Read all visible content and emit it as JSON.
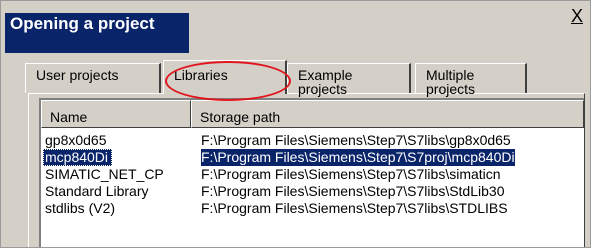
{
  "window": {
    "title": "Opening a project",
    "close_label": "X"
  },
  "tabs": [
    {
      "label": "User projects",
      "selected": false
    },
    {
      "label": "Libraries",
      "selected": true
    },
    {
      "label": "Example projects",
      "selected": false
    },
    {
      "label": "Multiple projects",
      "selected": false
    }
  ],
  "list": {
    "columns": [
      "Name",
      "Storage path"
    ],
    "rows": [
      {
        "name": "gp8x0d65",
        "path": "F:\\Program Files\\Siemens\\Step7\\S7libs\\gp8x0d65",
        "selected": false
      },
      {
        "name": "mcp840Di",
        "path": "F:\\Program Files\\Siemens\\Step7\\S7proj\\mcp840Di",
        "selected": true
      },
      {
        "name": "SIMATIC_NET_CP",
        "path": "F:\\Program Files\\Siemens\\Step7\\S7libs\\simaticn",
        "selected": false
      },
      {
        "name": "Standard Library",
        "path": "F:\\Program  Files\\Siemens\\Step7\\S7libs\\StdLib30",
        "selected": false
      },
      {
        "name": "stdlibs (V2)",
        "path": "F:\\Program  Files\\Siemens\\Step7\\S7libs\\STDLIBS",
        "selected": false
      }
    ]
  },
  "colors": {
    "title_bar": "#0a246a",
    "selection": "#0a246a",
    "highlight_ellipse": "#e0161c",
    "dialog_face": "#d4d0c8"
  }
}
